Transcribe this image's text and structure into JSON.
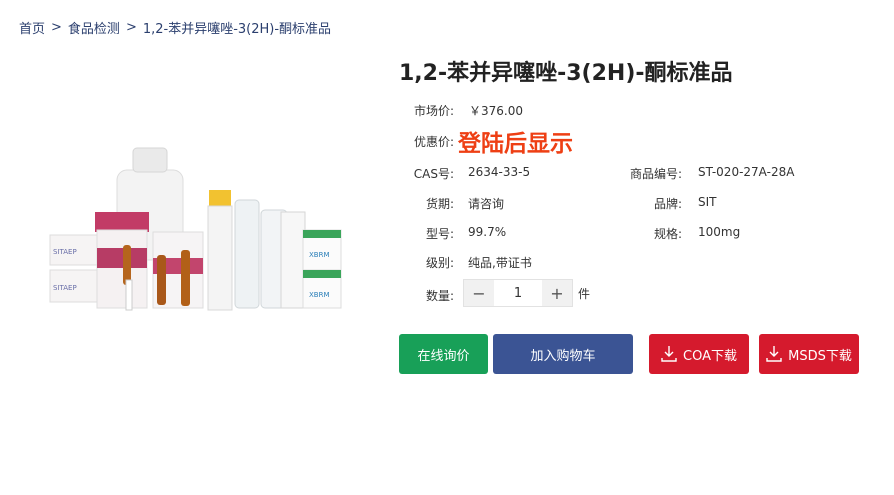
{
  "breadcrumb": {
    "items": [
      "首页",
      "食品检测",
      "1,2-苯并异噻唑-3(2H)-酮标准品"
    ],
    "separator": ">"
  },
  "product": {
    "title": "1,2-苯并异噻唑-3(2H)-酮标准品",
    "market_price_label": "市场价:",
    "market_price": "￥376.00",
    "promo_label": "优惠价:",
    "promo_text": "登陆后显示",
    "cas_label": "CAS号:",
    "cas": "2634-33-5",
    "code_label": "商品编号:",
    "code": "ST-020-27A-28A",
    "delivery_label": "货期:",
    "delivery": "请咨询",
    "brand_label": "品牌:",
    "brand": "SIT",
    "model_label": "型号:",
    "model": "99.7%",
    "spec_label": "规格:",
    "spec": "100mg",
    "grade_label": "级别:",
    "grade": "纯品,带证书",
    "qty_label": "数量:",
    "qty": "1",
    "qty_unit": "件",
    "minus": "−",
    "plus": "+"
  },
  "image_labels": {
    "box_brand": "SITAEP",
    "bottle_brand": "XBRM"
  },
  "actions": {
    "inquiry": "在线询价",
    "cart": "加入购物车",
    "coa": "COA下载",
    "msds": "MSDS下载"
  },
  "colors": {
    "promo": "#ee3f14",
    "inquiry": "#18a058",
    "cart": "#3b5494",
    "download": "#d51a2d",
    "breadcrumb": "#2b3f6e"
  }
}
